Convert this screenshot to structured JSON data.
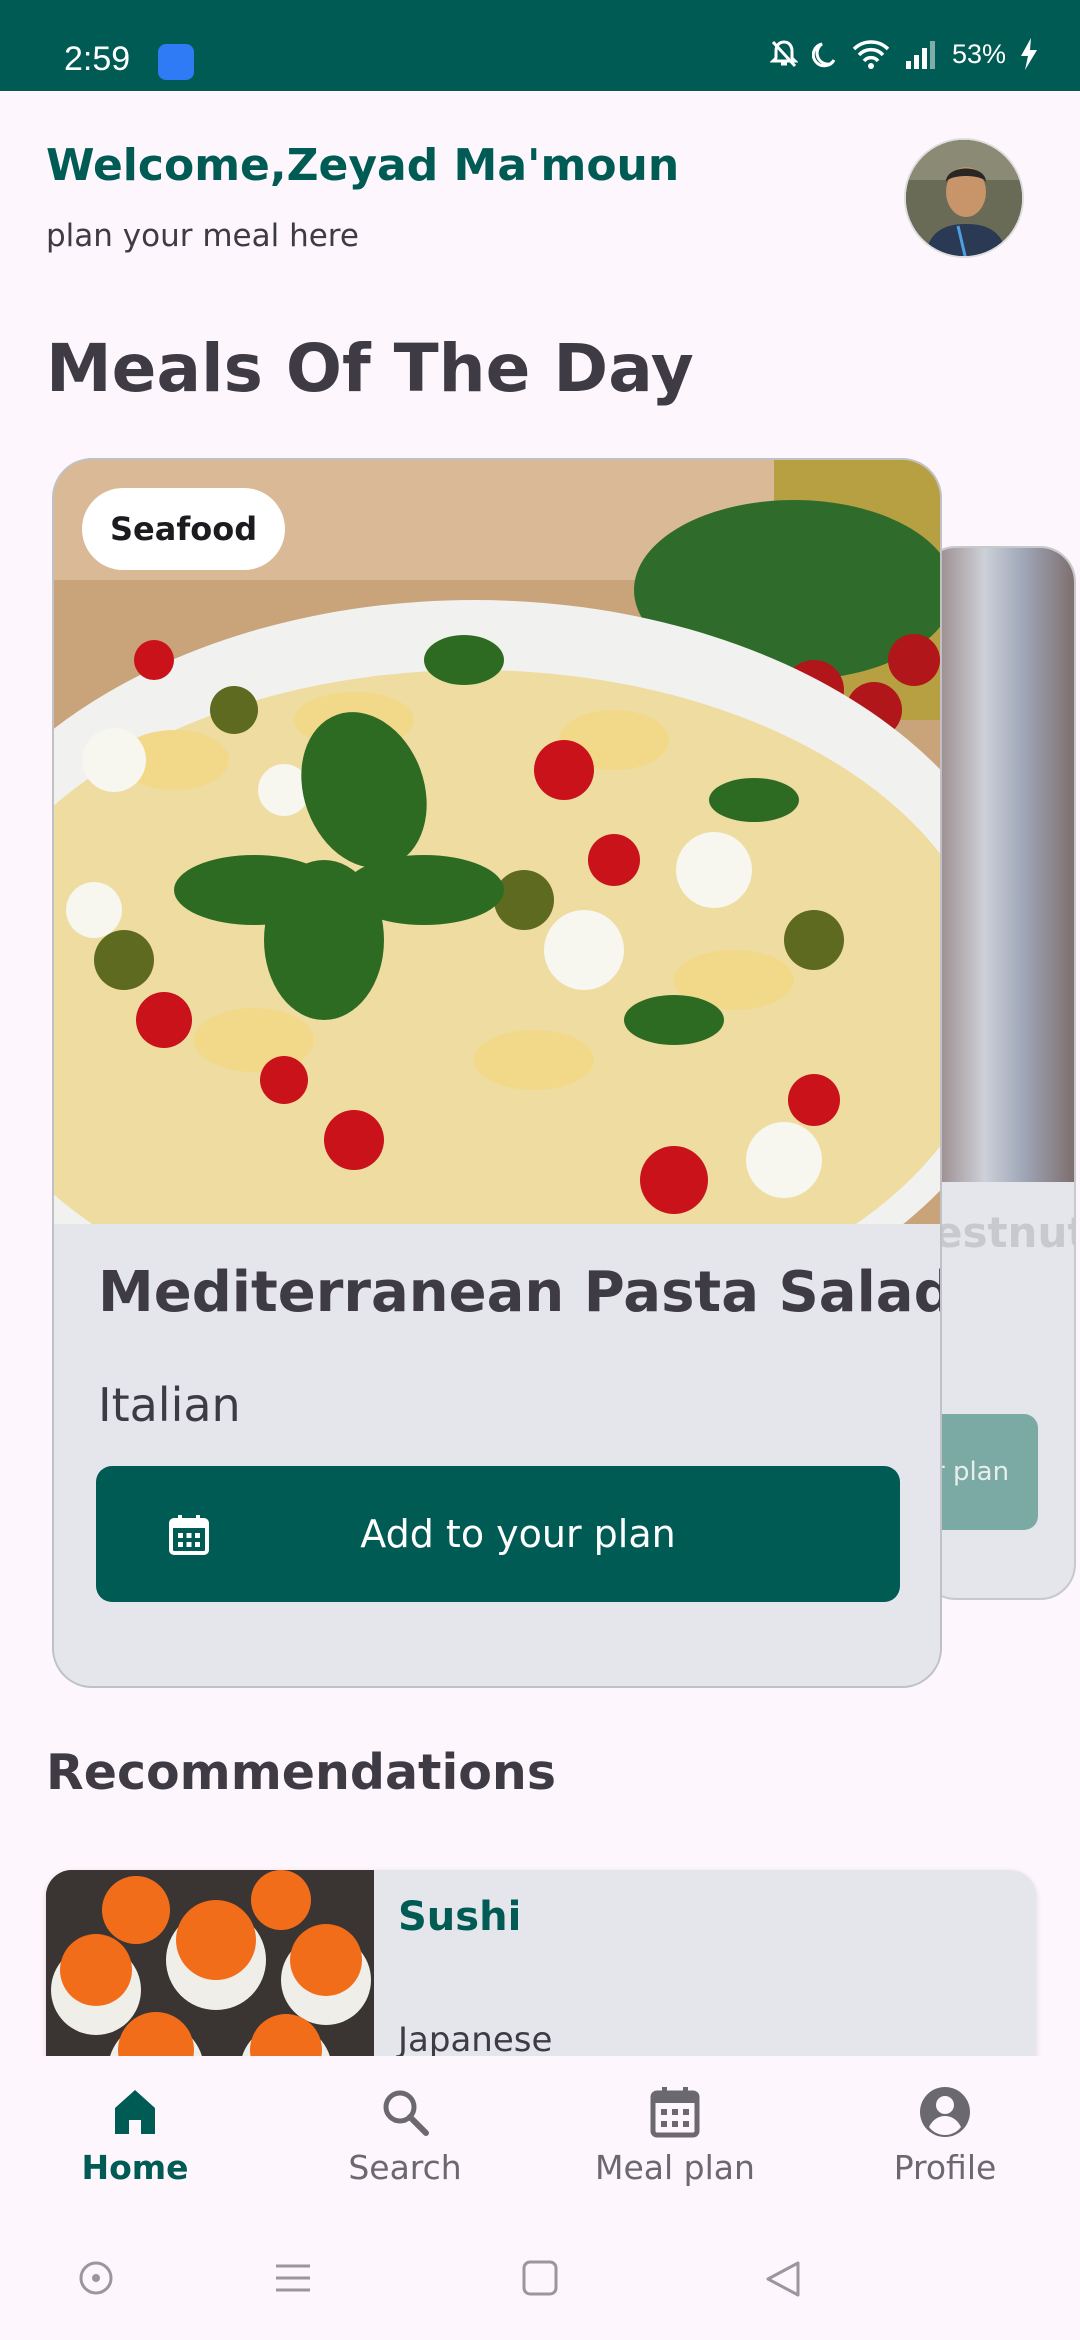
{
  "status_bar": {
    "time": "2:59",
    "battery": "53%"
  },
  "header": {
    "welcome": "Welcome,Zeyad Ma'moun",
    "subtitle": "plan your meal here"
  },
  "meals_of_day": {
    "title": "Meals Of The Day",
    "card": {
      "tag": "Seafood",
      "name": "Mediterranean Pasta Salad",
      "cuisine": "Italian",
      "button": "Add to your plan"
    },
    "peek_card": {
      "name_fragment": "estnut",
      "button_fragment": "r plan"
    }
  },
  "recommendations": {
    "title": "Recommendations",
    "items": [
      {
        "name": "Sushi",
        "cuisine": "Japanese"
      }
    ]
  },
  "bottom_nav": {
    "items": [
      {
        "label": "Home",
        "icon": "home-icon",
        "active": true
      },
      {
        "label": "Search",
        "icon": "search-icon",
        "active": false
      },
      {
        "label": "Meal plan",
        "icon": "calendar-icon",
        "active": false
      },
      {
        "label": "Profile",
        "icon": "profile-icon",
        "active": false
      }
    ]
  },
  "colors": {
    "primary": "#005b55",
    "background": "#fdf6fc",
    "card": "#e4e6ec"
  }
}
